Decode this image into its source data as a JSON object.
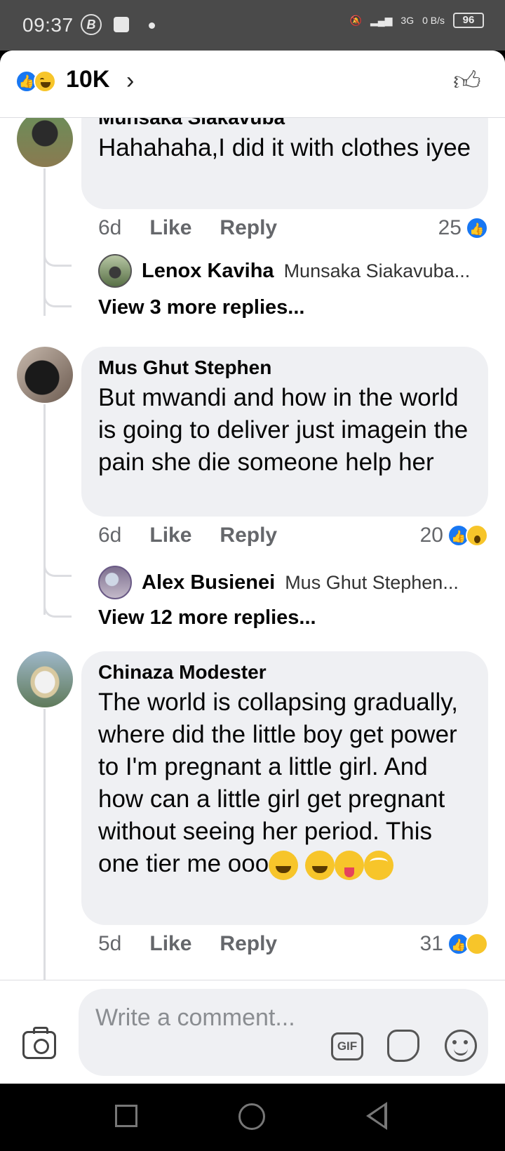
{
  "status_bar": {
    "time": "09:37",
    "network": "3G",
    "data_rate": "0 B/s",
    "battery": "96"
  },
  "header": {
    "reaction_count": "10K",
    "chevron": "›"
  },
  "comments": [
    {
      "author": "Munsaka Siakavuba",
      "text": "Hahahaha,I did it with clothes iyee",
      "time": "6d",
      "like_label": "Like",
      "reply_label": "Reply",
      "reaction_count": "25",
      "reply_preview": {
        "author": "Lenox Kaviha",
        "text": "Munsaka Siakavuba..."
      },
      "view_more": "View 3 more replies..."
    },
    {
      "author": "Mus Ghut Stephen",
      "text": "But mwandi and how in the world is going to deliver just imagein the pain she die someone help her",
      "time": "6d",
      "like_label": "Like",
      "reply_label": "Reply",
      "reaction_count": "20",
      "reply_preview": {
        "author": "Alex Busienei",
        "text": "Mus Ghut Stephen..."
      },
      "view_more": "View 12 more replies..."
    },
    {
      "author": "Chinaza Modester",
      "text": "The world is collapsing gradually, where did the little boy get power to I'm pregnant a little girl. And how can a little girl get pregnant without seeing her period. This one tier me ooo",
      "time": "5d",
      "like_label": "Like",
      "reply_label": "Reply",
      "reaction_count": "31"
    }
  ],
  "composer": {
    "placeholder": "Write a comment...",
    "gif_label": "GIF"
  }
}
